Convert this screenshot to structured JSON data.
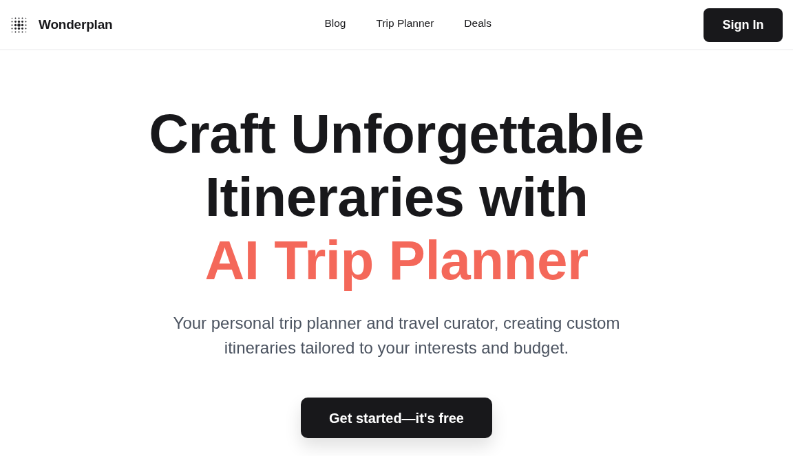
{
  "header": {
    "brand": "Wonderplan",
    "nav": [
      {
        "label": "Blog"
      },
      {
        "label": "Trip Planner"
      },
      {
        "label": "Deals"
      }
    ],
    "sign_in": "Sign In"
  },
  "hero": {
    "title_lines": [
      {
        "text": "Craft Unforgettable",
        "accent": false
      },
      {
        "text": "Itineraries with",
        "accent": false
      },
      {
        "text": "AI Trip Planner",
        "accent": true
      }
    ],
    "subtitle": "Your personal trip planner and travel curator, creating custom itineraries tailored to your interests and budget.",
    "cta": "Get started—it's free"
  }
}
